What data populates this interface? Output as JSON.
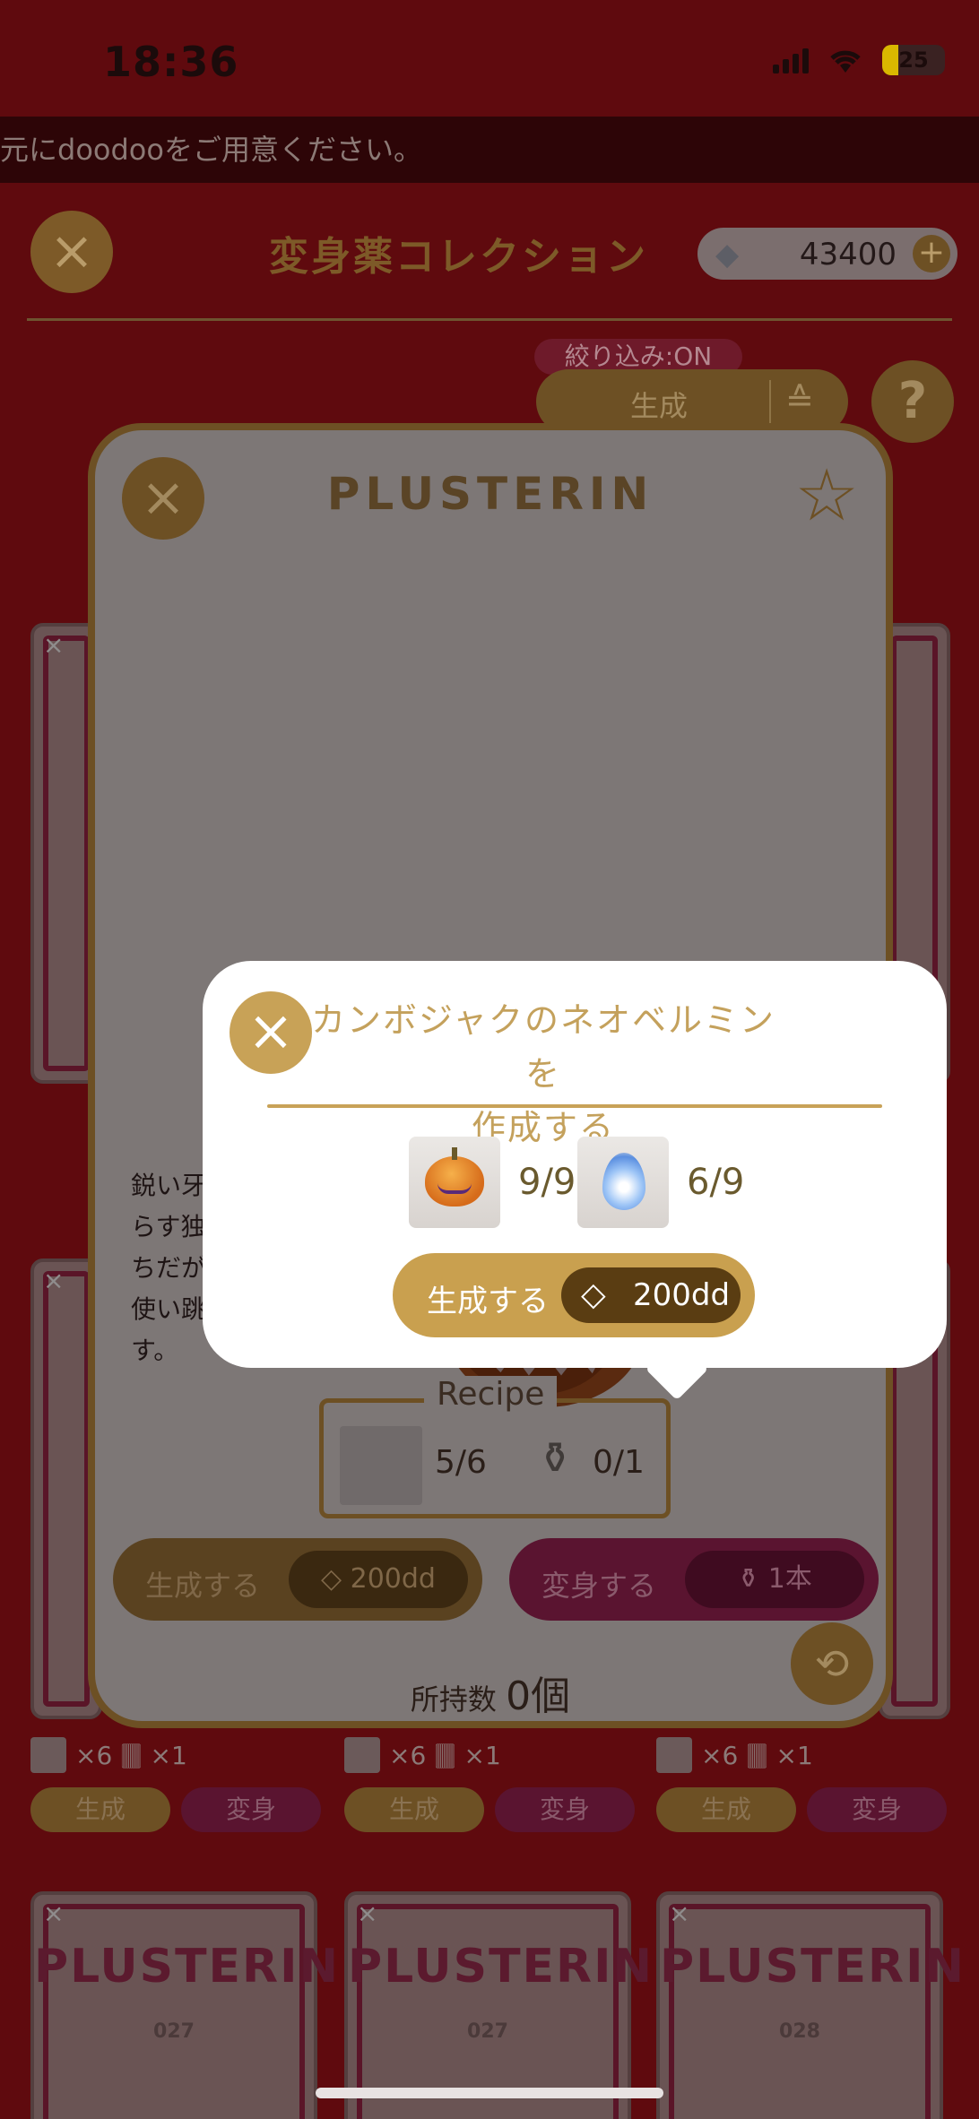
{
  "status_bar": {
    "time": "18:36",
    "battery": "25"
  },
  "ticker": {
    "text": "元にdoodooをご用意ください。"
  },
  "header": {
    "title": "変身薬コレクション",
    "currency": "43400",
    "currency_icon": "gem-icon"
  },
  "filter": {
    "badge": "絞り込み:ON",
    "sort_label": "生成"
  },
  "background_cards": [
    {
      "brand": "PLUSTERIN",
      "number": "027"
    },
    {
      "brand": "PLUSTERIN",
      "number": "027"
    },
    {
      "brand": "PLUSTERIN",
      "number": "028"
    }
  ],
  "card_rows": [
    {
      "cost_a": "×6",
      "cost_b": "×1",
      "gen": "生成",
      "transform": "変身"
    },
    {
      "cost_a": "×6",
      "cost_b": "×1",
      "gen": "生成",
      "transform": "変身"
    },
    {
      "cost_a": "×6",
      "cost_b": "×1",
      "gen": "生成",
      "transform": "変身"
    }
  ],
  "detail": {
    "title": "PLUSTERIN",
    "description": "鋭い牙 らす独 ちだが 使い跳 す。",
    "recipe": {
      "caption": "Recipe",
      "item_count": "5/6",
      "bottle_count": "0/1"
    },
    "generate": {
      "label": "生成する",
      "price": "200dd"
    },
    "transform": {
      "label": "変身する",
      "count": "1本"
    },
    "owned": {
      "label": "所持数",
      "value": "0個"
    }
  },
  "popup": {
    "title_line1": "カンボジャクのネオベルミンを",
    "title_line2": "作成する",
    "ingredients": [
      {
        "icon": "pumpkin-icon",
        "count": "9/9"
      },
      {
        "icon": "blue-drop-icon",
        "count": "6/9"
      }
    ],
    "button": {
      "label": "生成する",
      "price": "200dd"
    }
  },
  "colors": {
    "gold": "#c8a257",
    "dark_gold": "#5a3d12",
    "backdrop": "#5f0a0e",
    "white": "#ffffff"
  }
}
